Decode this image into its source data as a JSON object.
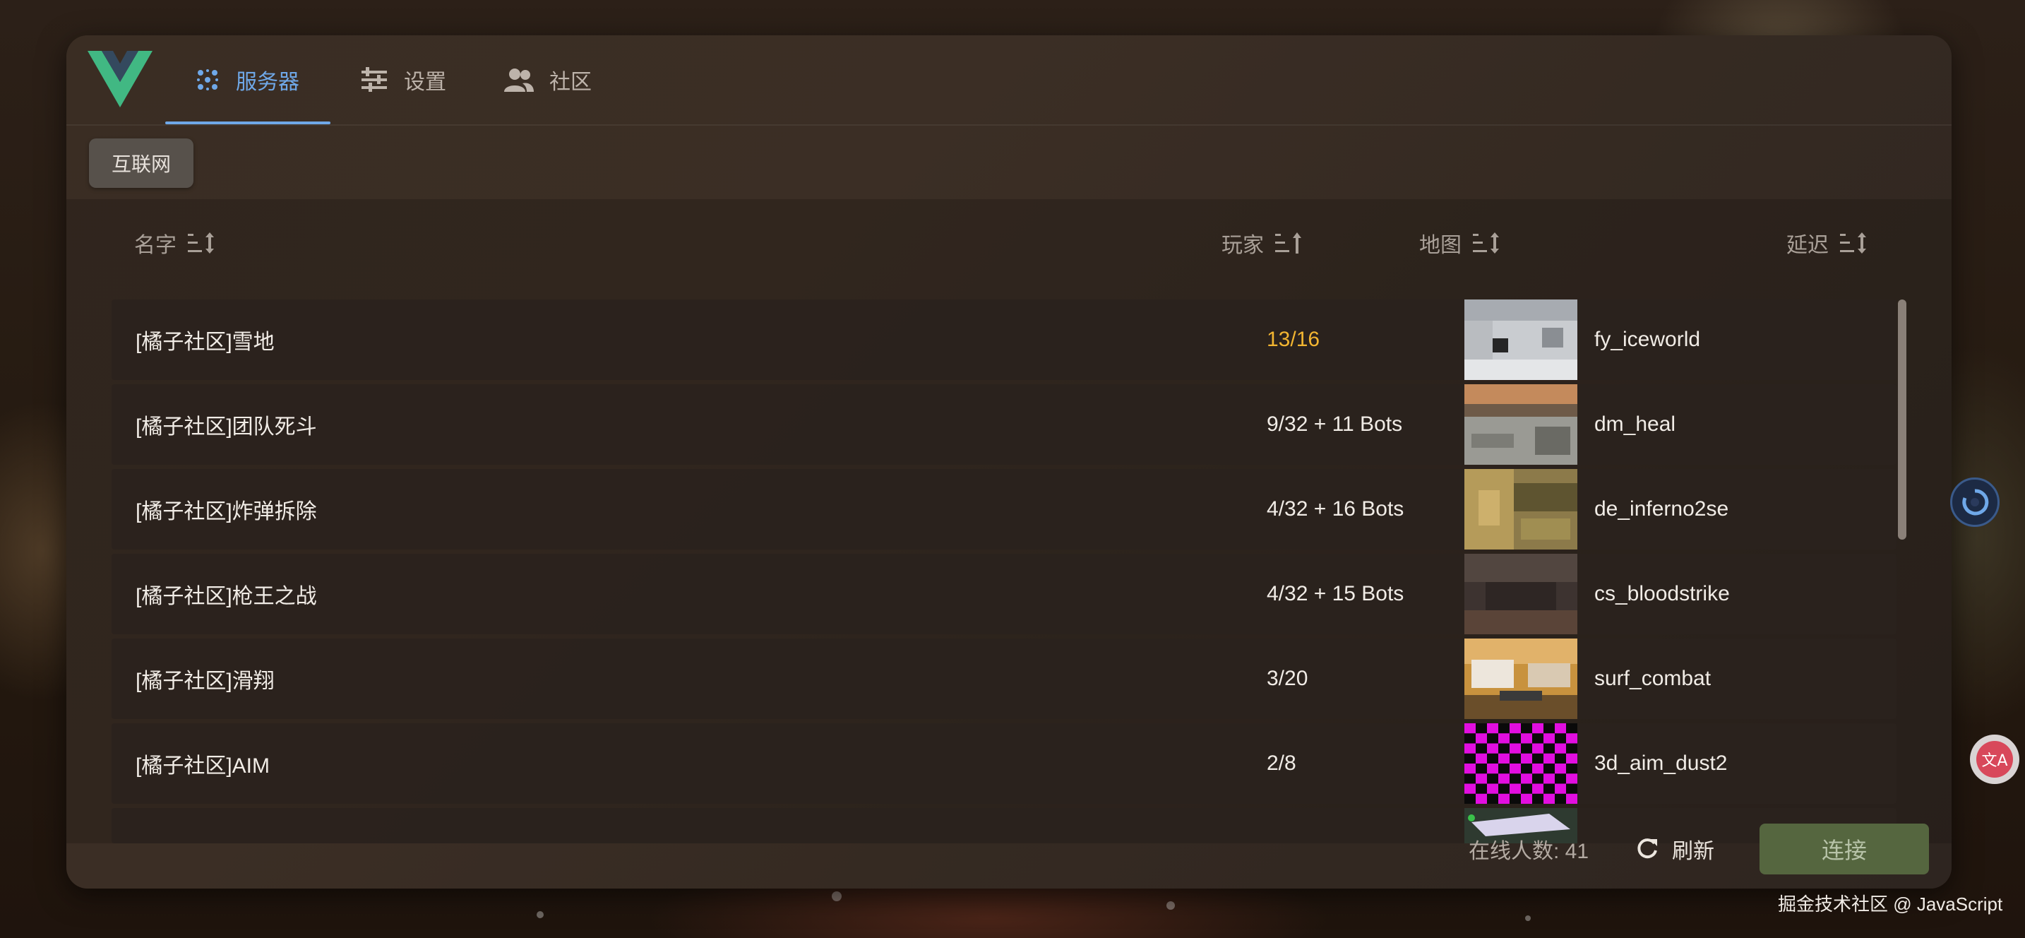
{
  "header": {
    "tabs": [
      {
        "label": "服务器",
        "icon": "servers-icon",
        "active": true
      },
      {
        "label": "设置",
        "icon": "sliders-icon",
        "active": false
      },
      {
        "label": "社区",
        "icon": "people-icon",
        "active": false
      }
    ]
  },
  "subtabs": [
    {
      "label": "互联网",
      "active": true
    }
  ],
  "table": {
    "columns": {
      "name": "名字",
      "players": "玩家",
      "map": "地图",
      "ping": "延迟"
    },
    "rows": [
      {
        "name": "[橘子社区]雪地",
        "players": "13/16",
        "map": "fy_iceworld",
        "highlight_color": "#f2b531"
      },
      {
        "name": "[橘子社区]团队死斗",
        "players": "9/32 + 11 Bots",
        "map": "dm_heal"
      },
      {
        "name": "[橘子社区]炸弹拆除",
        "players": "4/32 + 16 Bots",
        "map": "de_inferno2se"
      },
      {
        "name": "[橘子社区]枪王之战",
        "players": "4/32 + 15 Bots",
        "map": "cs_bloodstrike"
      },
      {
        "name": "[橘子社区]滑翔",
        "players": "3/20",
        "map": "surf_combat"
      },
      {
        "name": "[橘子社区]AIM",
        "players": "2/8",
        "map": "3d_aim_dust2"
      }
    ]
  },
  "footer": {
    "online": "在线人数: 41",
    "refresh_label": "刷新",
    "connect_label": "连接"
  },
  "watermark": "掘金技术社区 @ JavaScript",
  "colors": {
    "accent": "#6fa8e8",
    "connect_bg": "#55663f",
    "warning": "#f2b531"
  }
}
